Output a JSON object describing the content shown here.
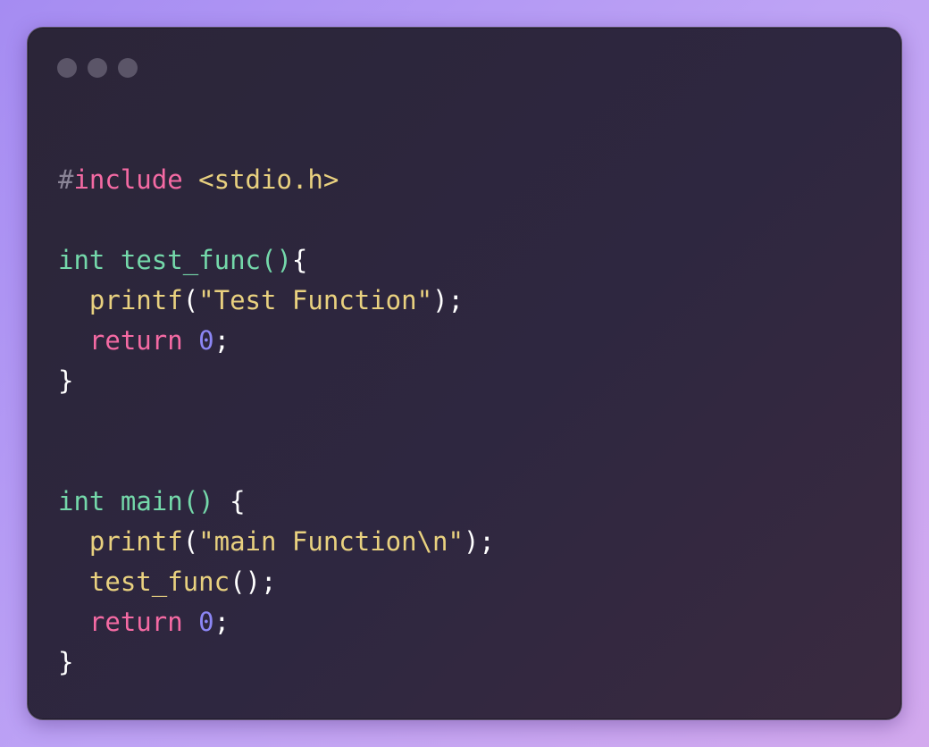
{
  "window": {
    "controls": [
      "window-dot-icon",
      "window-dot-icon",
      "window-dot-icon"
    ]
  },
  "code": {
    "language": "c",
    "lines": [
      [
        {
          "t": "#",
          "k": "hash"
        },
        {
          "t": "include",
          "k": "dir"
        },
        {
          "t": " ",
          "k": "punc"
        },
        {
          "t": "<stdio.h>",
          "k": "hdr"
        }
      ],
      [],
      [
        {
          "t": "int",
          "k": "type"
        },
        {
          "t": " ",
          "k": "punc"
        },
        {
          "t": "test_func",
          "k": "fn"
        },
        {
          "t": "()",
          "k": "paren-g"
        },
        {
          "t": "{",
          "k": "punc"
        }
      ],
      [
        {
          "t": "  ",
          "k": "punc"
        },
        {
          "t": "printf",
          "k": "call"
        },
        {
          "t": "(",
          "k": "punc"
        },
        {
          "t": "\"Test Function\"",
          "k": "str"
        },
        {
          "t": ");",
          "k": "punc"
        }
      ],
      [
        {
          "t": "  ",
          "k": "punc"
        },
        {
          "t": "return",
          "k": "kw"
        },
        {
          "t": " ",
          "k": "punc"
        },
        {
          "t": "0",
          "k": "num"
        },
        {
          "t": ";",
          "k": "punc"
        }
      ],
      [
        {
          "t": "}",
          "k": "punc"
        }
      ],
      [],
      [],
      [
        {
          "t": "int",
          "k": "type"
        },
        {
          "t": " ",
          "k": "punc"
        },
        {
          "t": "main",
          "k": "fn"
        },
        {
          "t": "()",
          "k": "paren-g"
        },
        {
          "t": " {",
          "k": "punc"
        }
      ],
      [
        {
          "t": "  ",
          "k": "punc"
        },
        {
          "t": "printf",
          "k": "call"
        },
        {
          "t": "(",
          "k": "punc"
        },
        {
          "t": "\"main Function\\n\"",
          "k": "str"
        },
        {
          "t": ");",
          "k": "punc"
        }
      ],
      [
        {
          "t": "  ",
          "k": "punc"
        },
        {
          "t": "test_func",
          "k": "call"
        },
        {
          "t": "();",
          "k": "punc"
        }
      ],
      [
        {
          "t": "  ",
          "k": "punc"
        },
        {
          "t": "return",
          "k": "kw"
        },
        {
          "t": " ",
          "k": "punc"
        },
        {
          "t": "0",
          "k": "num"
        },
        {
          "t": ";",
          "k": "punc"
        }
      ],
      [
        {
          "t": "}",
          "k": "punc"
        }
      ]
    ]
  },
  "colors": {
    "background_start": "#a58cf2",
    "background_end": "#d3a9ee",
    "window_bg": "#2b2538",
    "window_border": "#585064",
    "dot": "#5b5568",
    "hash": "#8a8496",
    "directive": "#f46aa3",
    "header": "#e9d17f",
    "type": "#74d8aa",
    "function_name": "#74d8aa",
    "call": "#e9d17f",
    "string": "#e9d17f",
    "keyword": "#f46aa3",
    "number": "#8c86f5",
    "punctuation": "#ffffff"
  }
}
